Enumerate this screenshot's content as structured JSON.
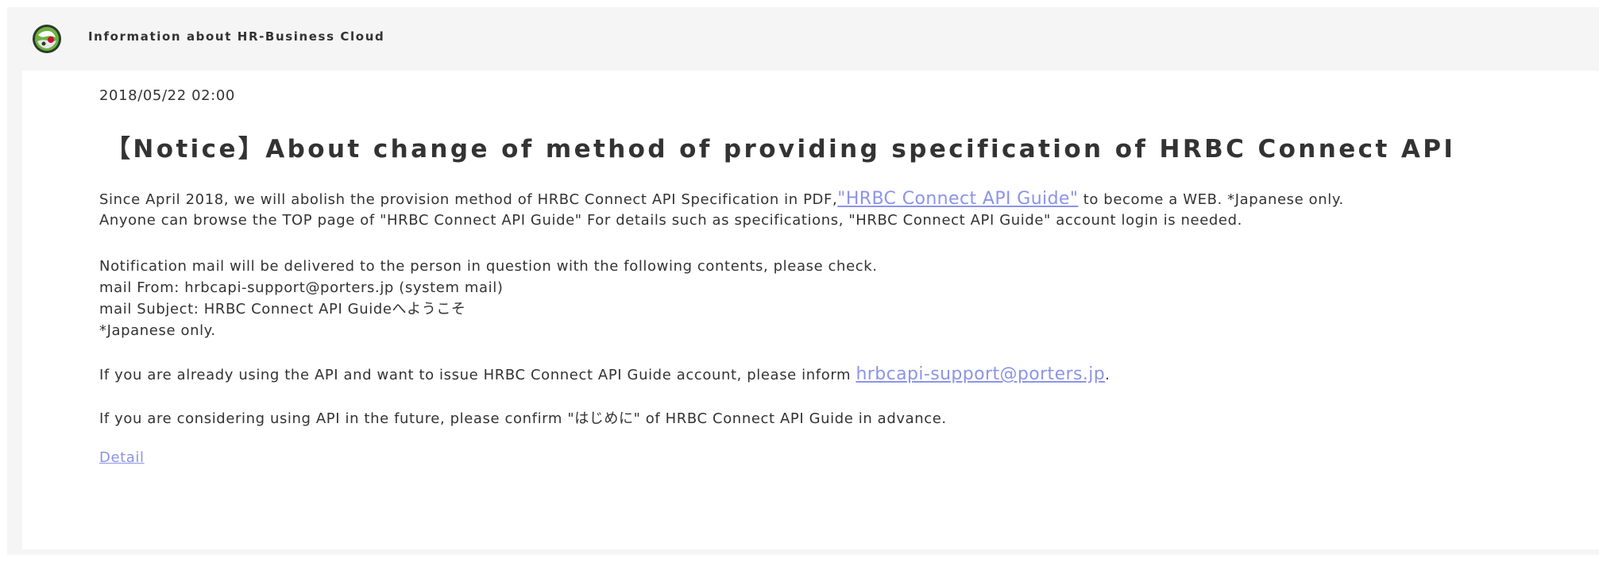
{
  "header": {
    "title": "Information about HR-Business Cloud",
    "logo_icon": "globe-logo-icon"
  },
  "notice": {
    "date": "2018/05/22 02:00",
    "title": "【Notice】About change of method of providing specification of HRBC Connect API",
    "p1_line1_before": "Since April 2018, we will abolish the provision method of HRBC Connect API Specification in PDF,",
    "p1_line1_link": "\"HRBC Connect API Guide\"",
    "p1_line1_after": " to become a WEB. *Japanese only.",
    "p1_line2": "Anyone can browse the TOP page of \"HRBC Connect API Guide\" For details such as specifications, \"HRBC Connect API Guide\" account login is needed.",
    "p2_line1": "Notification mail will be delivered to the person in question with the following contents, please check.",
    "p2_line2": "mail From: hrbcapi-support@porters.jp (system mail)",
    "p2_line3": "mail Subject: HRBC Connect API Guideへようこそ",
    "p2_line4": "*Japanese only.",
    "p3_before": "If you are already using the API and want to issue HRBC Connect API Guide account, please inform ",
    "p3_link": "hrbcapi-support@porters.jp",
    "p3_after": ".",
    "p4": "If you are considering using API in the future, please confirm \"はじめに\" of HRBC Connect API Guide in advance.",
    "detail_link": "Detail"
  },
  "colors": {
    "link": "#8c94e8",
    "text": "#333333",
    "background": "#f5f5f5",
    "panel": "#ffffff"
  }
}
